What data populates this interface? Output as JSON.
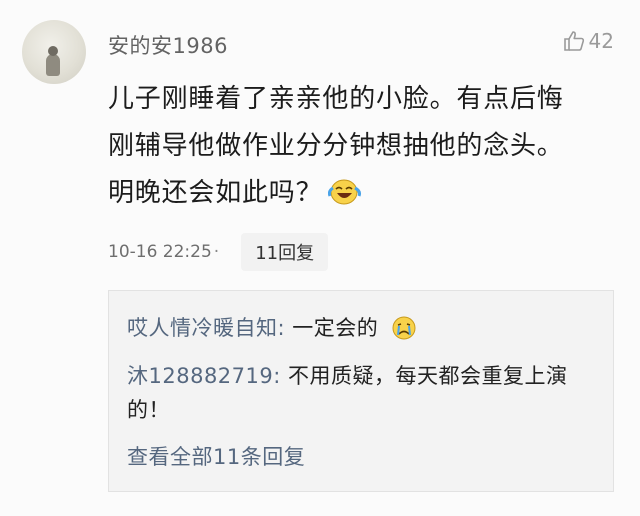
{
  "comment": {
    "username": "安的安1986",
    "likes": "42",
    "text_line1": "儿子刚睡着了亲亲他的小脸。有点后悔",
    "text_line2": "刚辅导他做作业分分钟想抽他的念头。",
    "text_line3": "明晚还会如此吗？",
    "timestamp": "10-16 22:25",
    "separator": "·",
    "reply_count_label": "11回复"
  },
  "replies": [
    {
      "author": "哎人情冷暖自知:",
      "text": "一定会的"
    },
    {
      "author": "沐128882719:",
      "text": "不用质疑，每天都会重复上演的！"
    }
  ],
  "view_all_label": "查看全部11条回复",
  "icons": {
    "like": "thumbs-up-icon",
    "emoji_laugh_cry": "laugh-cry-emoji-icon",
    "emoji_crying": "crying-emoji-icon"
  },
  "colors": {
    "username": "#636363",
    "reply_author": "#55677f",
    "body_text": "#1c1c1c"
  }
}
